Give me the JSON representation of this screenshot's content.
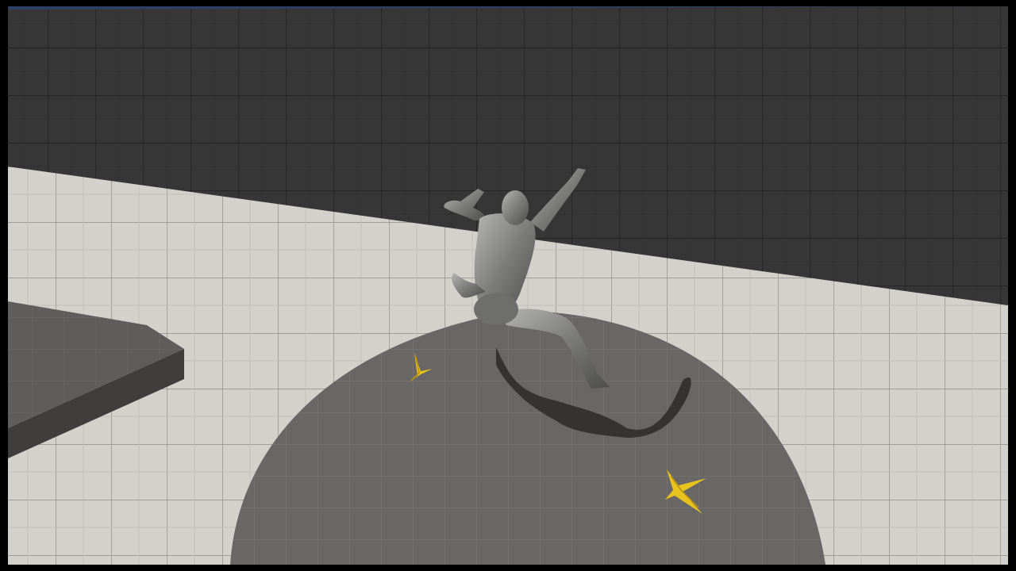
{
  "scene": {
    "description_labels": {
      "character": "mannequin-character",
      "platform": "circular-platform",
      "item": "banana-peel"
    },
    "colors": {
      "wall": "#3a3a3a",
      "floor": "#c8c6c2",
      "platform": "#6e6c6a",
      "banana": "#e8c21e",
      "mannequin": "#8a8a88",
      "sky": "#2f3e63"
    },
    "items": [
      "banana-peel",
      "banana-peel"
    ]
  }
}
